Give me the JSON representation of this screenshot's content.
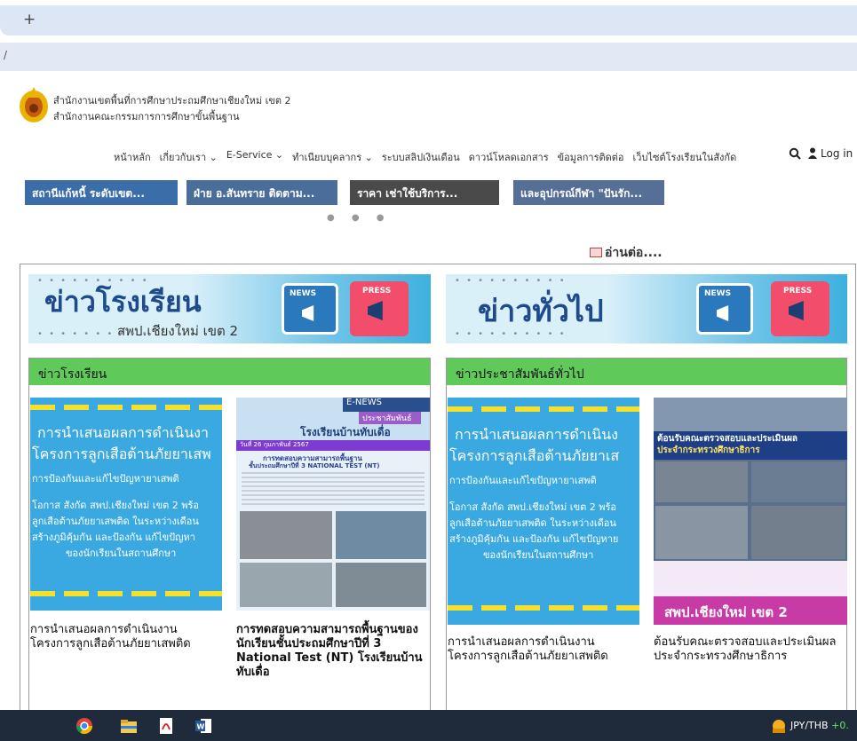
{
  "browser": {
    "new_tab_label": "+",
    "address_fragment": "/"
  },
  "header": {
    "org_line1": "สำนักงานเขตพื้นที่การศึกษาประถมศึกษาเชียงใหม่ เขต 2",
    "org_line2": "สำนักงานคณะกรรมการการศึกษาขั้นพื้นฐาน",
    "nav": [
      "หน้าหลัก",
      "เกี่ยวกับเรา ⌄",
      "E-Service ⌄",
      "ทำเนียบบุคลากร ⌄",
      "ระบบสลิปเงินเดือน",
      "ดาวน์โหลดเอกสาร",
      "ข้อมูลการติดต่อ",
      "เว็บไซต์โรงเรียนในสังกัด"
    ],
    "login_label": "Log in"
  },
  "slider": {
    "slides": [
      "สถานีแก้หนี้ ระดับเขต...",
      "ฝ่าย อ.สันทราย ติดตาม...",
      "ราคา เช่าใช้บริการ...",
      "และอุปกรณ์กีฬา \"ปันรัก..."
    ],
    "dots": "● ● ●"
  },
  "read_more": "อ่านต่อ....",
  "banners": {
    "school": {
      "title": "ข่าวโรงเรียน",
      "subtitle": "สพป.เชียงใหม่ เขต 2",
      "news_label": "NEWS",
      "press_label": "PRESS"
    },
    "general": {
      "title": "ข่าวทั่วไป",
      "news_label": "NEWS",
      "press_label": "PRESS"
    }
  },
  "columns": {
    "school": {
      "heading": "ข่าวโรงเรียน",
      "cards": [
        {
          "thumb_lines": [
            "การนำเสนอผลการดำเนินงา",
            "โครงการลูกเสือต้านภัยยาเสพ",
            "การป้องกันและแก้ไขปัญหายาเสพติ",
            "โอกาส สังกัด สพป.เชียงใหม่ เขต 2 พร้อ",
            "ลูกเสือต้านภัยยาเสพติด ในระหว่างเดือน",
            "สร้างภูมิคุ้มกัน และป้องกัน แก้ไขปัญหา",
            "ของนักเรียนในสถานศึกษา"
          ],
          "title": "การนำเสนอผลการดำเนินงาน โครงการลูกเสือต้านภัยยาเสพติด"
        },
        {
          "thumb_lines": [
            "E-NEWS",
            "ประชาสัมพันธ์",
            "โรงเรียนบ้านทับเดื่อ",
            "วันที่ 26 กุมภาพันธ์ 2567",
            "การทดสอบความสามารถพื้นฐาน",
            "ชั้นประถมศึกษาปีที่ 3 NATIONAL TEST (NT)"
          ],
          "title": "การทดสอบความสามารถพื้นฐานของนักเรียนชั้นประถมศึกษาปีที่ 3 National Test (NT) โรงเรียนบ้านทับเดื่อ"
        }
      ]
    },
    "general": {
      "heading": "ข่าวประชาสัมพันธ์ทั่วไป",
      "cards": [
        {
          "thumb_lines": [
            "การนำเสนอผลการดำเนินง",
            "โครงการลูกเสือต้านภัยยาเส",
            "การป้องกันและแก้ไขปัญหายาเสพติ",
            "โอกาส สังกัด สพป.เชียงใหม่ เขต 2 พร้อ",
            "ลูกเสือต้านภัยยาเสพติด ในระหว่างเดือน",
            "สร้างภูมิคุ้มกัน และป้องกัน แก้ไขปัญหาย",
            "ของนักเรียนในสถานศึกษา"
          ],
          "title": "การนำเสนอผลการดำเนินงาน โครงการลูกเสือต้านภัยยาเสพติด"
        },
        {
          "thumb_lines": [
            "ต้อนรับคณะตรวจสอบและประเมินผล",
            "ประจำกระทรวงศึกษาธิการ",
            "สพป.เชียงใหม่ เขต 2"
          ],
          "title": "ต้อนรับคณะตรวจสอบและประเมินผลประจำกระทรวงศึกษาธิการ"
        }
      ]
    }
  },
  "taskbar": {
    "ticker_label": "JPY/THB",
    "ticker_change": "+0.",
    "apps": [
      "chrome-icon",
      "file-explorer-icon",
      "pdf-icon",
      "word-icon"
    ]
  },
  "colors": {
    "green_header": "#5fc95a",
    "banner_blue": "#3fb0de",
    "title_navy": "#1f4a8c"
  }
}
